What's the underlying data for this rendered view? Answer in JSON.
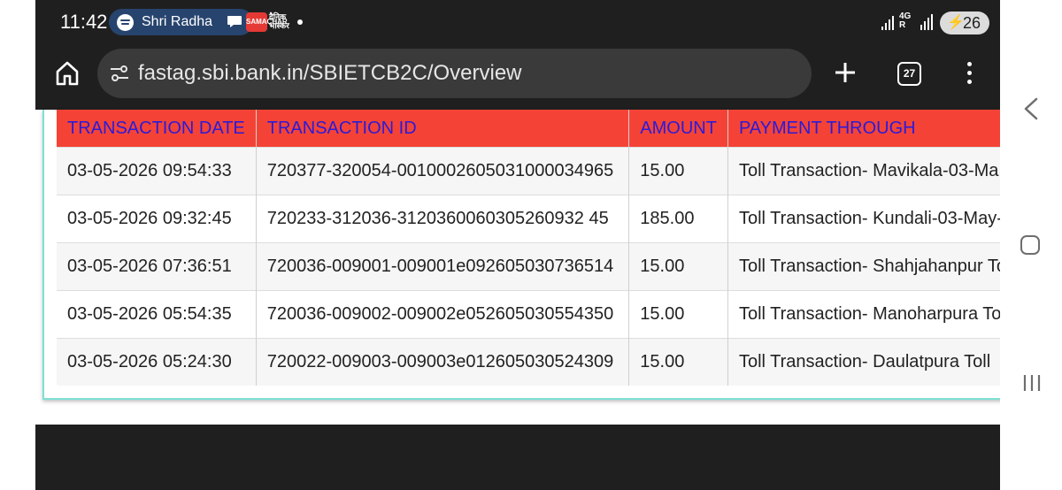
{
  "status_bar": {
    "time": "11:42",
    "media_title": "Shri Radha",
    "notif_app_1": "SAMACHAR",
    "notif_app_2_lines": [
      "दैनिक",
      "भास्कर"
    ],
    "network_lines": [
      "4G",
      "R"
    ],
    "battery_level": "26",
    "battery_icon": "bolt-icon"
  },
  "browser": {
    "url": "fastag.sbi.bank.in/SBIETCB2C/Overview",
    "tab_count": "27",
    "icons": [
      "home-icon",
      "site-settings-icon",
      "plus-icon",
      "tabs-icon",
      "menu-dots-icon"
    ]
  },
  "table": {
    "header_bg": "#f44336",
    "header_text_color": "#2b1bd9",
    "headers": [
      "TRANSACTION DATE",
      "TRANSACTION ID",
      "AMOUNT",
      "PAYMENT THROUGH"
    ],
    "rows": [
      {
        "date": "03-05-2026 09:54:33",
        "id": "720377-320054-0010002605031000034965",
        "amount": "15.00",
        "payment": "Toll Transaction- Mavikala-03-Ma"
      },
      {
        "date": "03-05-2026 09:32:45",
        "id": "720233-312036-3120360060305260932 45",
        "amount": "185.00",
        "payment": "Toll Transaction- Kundali-03-May-"
      },
      {
        "date": "03-05-2026 07:36:51",
        "id": "720036-009001-009001e092605030736514",
        "amount": "15.00",
        "payment": "Toll Transaction- Shahjahanpur To"
      },
      {
        "date": "03-05-2026 05:54:35",
        "id": "720036-009002-009002e052605030554350",
        "amount": "15.00",
        "payment": "Toll Transaction- Manoharpura To"
      },
      {
        "date": "03-05-2026 05:24:30",
        "id": "720022-009003-009003e012605030524309",
        "amount": "15.00",
        "payment": "Toll Transaction- Daulatpura Toll"
      }
    ]
  },
  "system_nav": {
    "icons": [
      "back-icon",
      "home-circle-icon",
      "recent-apps-icon"
    ]
  }
}
